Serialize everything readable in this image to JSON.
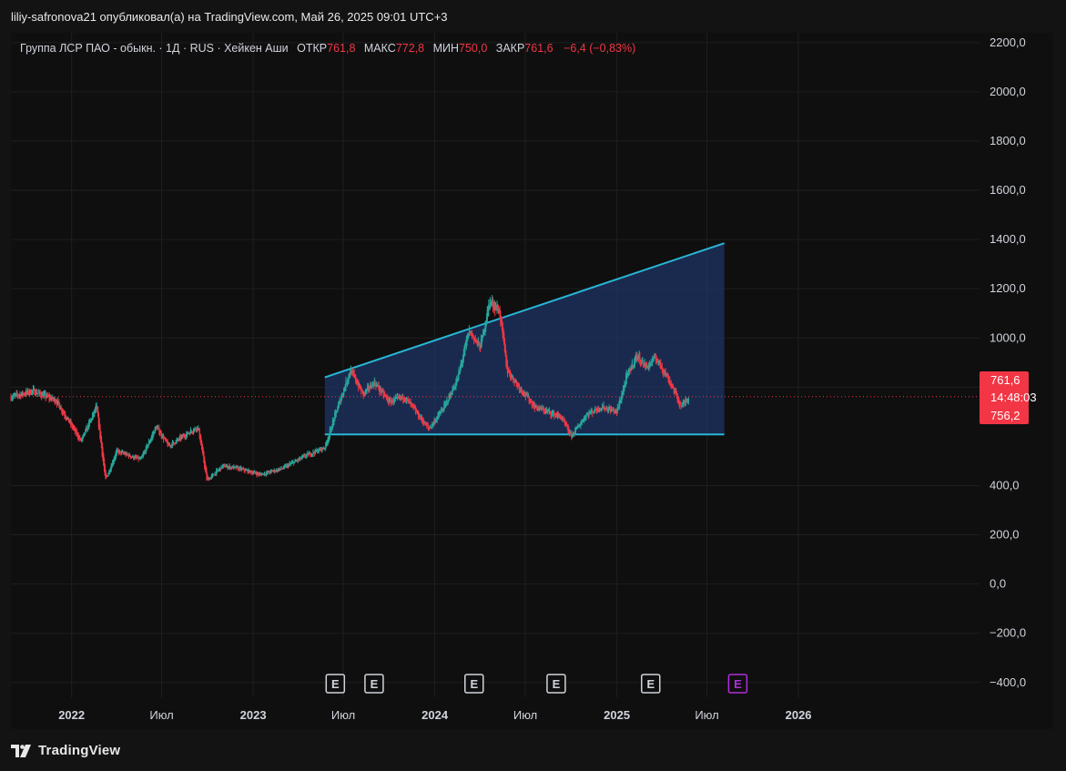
{
  "header": {
    "published_by": "liliy-safronova21 опубликовал(а) на TradingView.com, Май 26, 2025 09:01 UTC+3"
  },
  "legend": {
    "symbol": "Группа ЛСР ПАО - обыкн. · 1Д · RUS · Хейкен Аши",
    "open_label": "ОТКР",
    "open": "761,8",
    "high_label": "МАКС",
    "high": "772,8",
    "low_label": "МИН",
    "low": "750,0",
    "close_label": "ЗАКР",
    "close": "761,6",
    "change": "−6,4 (−0,83%)"
  },
  "price_tags": {
    "last": "761,6",
    "countdown": "14:48:03",
    "level": "756,2"
  },
  "footer": {
    "brand": "TradingView"
  },
  "colors": {
    "up": "#26a69a",
    "down": "#f23645",
    "trendline": "#29b6d6",
    "pattern_fill": "#1e3566",
    "earnings": "#d1d4dc",
    "earnings_upcoming": "#b02fd9"
  },
  "chart_data": {
    "type": "candlestick",
    "style": "Heikin Ashi",
    "y_axis": {
      "ticks": [
        -400,
        -200,
        0,
        200,
        400,
        800,
        1000,
        1200,
        1400,
        1600,
        1800,
        2000,
        2200
      ],
      "tick_labels": [
        "−400,0",
        "−200,0",
        "0,0",
        "200,0",
        "400,0",
        "800,0",
        "1000,0",
        "1200,0",
        "1400,0",
        "1600,0",
        "1800,0",
        "2000,0",
        "2200,0"
      ],
      "range": [
        -460,
        2240
      ]
    },
    "x_axis": {
      "range": [
        "2021-09-01",
        "2026-12-31"
      ],
      "ticks": [
        {
          "label": "2022",
          "date": "2022-01-01",
          "bold": true
        },
        {
          "label": "Июл",
          "date": "2022-07-01",
          "bold": false
        },
        {
          "label": "2023",
          "date": "2023-01-01",
          "bold": true
        },
        {
          "label": "Июл",
          "date": "2023-07-01",
          "bold": false
        },
        {
          "label": "2024",
          "date": "2024-01-01",
          "bold": true
        },
        {
          "label": "Июл",
          "date": "2024-07-01",
          "bold": false
        },
        {
          "label": "2025",
          "date": "2025-01-01",
          "bold": true
        },
        {
          "label": "Июл",
          "date": "2025-07-01",
          "bold": false
        },
        {
          "label": "2026",
          "date": "2026-01-01",
          "bold": true
        }
      ]
    },
    "last_price": 761.6,
    "price_path": [
      [
        "2021-09-01",
        760
      ],
      [
        "2021-10-15",
        785
      ],
      [
        "2021-12-01",
        745
      ],
      [
        "2022-01-20",
        580
      ],
      [
        "2022-02-20",
        720
      ],
      [
        "2022-03-10",
        420
      ],
      [
        "2022-04-01",
        540
      ],
      [
        "2022-05-20",
        505
      ],
      [
        "2022-06-20",
        640
      ],
      [
        "2022-07-15",
        560
      ],
      [
        "2022-08-20",
        610
      ],
      [
        "2022-09-12",
        640
      ],
      [
        "2022-09-30",
        420
      ],
      [
        "2022-11-01",
        480
      ],
      [
        "2022-12-01",
        470
      ],
      [
        "2023-01-15",
        445
      ],
      [
        "2023-03-01",
        470
      ],
      [
        "2023-04-15",
        520
      ],
      [
        "2023-05-25",
        555
      ],
      [
        "2023-06-15",
        690
      ],
      [
        "2023-07-15",
        870
      ],
      [
        "2023-08-10",
        770
      ],
      [
        "2023-09-01",
        820
      ],
      [
        "2023-10-01",
        740
      ],
      [
        "2023-11-01",
        760
      ],
      [
        "2023-12-20",
        630
      ],
      [
        "2024-01-20",
        720
      ],
      [
        "2024-02-15",
        830
      ],
      [
        "2024-03-10",
        1030
      ],
      [
        "2024-04-01",
        960
      ],
      [
        "2024-04-20",
        1150
      ],
      [
        "2024-05-10",
        1110
      ],
      [
        "2024-05-25",
        870
      ],
      [
        "2024-06-15",
        810
      ],
      [
        "2024-07-20",
        720
      ],
      [
        "2024-09-10",
        680
      ],
      [
        "2024-10-01",
        600
      ],
      [
        "2024-11-01",
        690
      ],
      [
        "2024-12-01",
        720
      ],
      [
        "2025-01-01",
        700
      ],
      [
        "2025-01-20",
        840
      ],
      [
        "2025-02-10",
        930
      ],
      [
        "2025-03-01",
        880
      ],
      [
        "2025-03-20",
        920
      ],
      [
        "2025-04-10",
        850
      ],
      [
        "2025-04-25",
        790
      ],
      [
        "2025-05-10",
        720
      ],
      [
        "2025-05-26",
        761.6
      ]
    ],
    "pattern": {
      "type": "ascending broadening wedge",
      "upper_line": [
        [
          "2023-05-25",
          840
        ],
        [
          "2025-08-05",
          1385
        ]
      ],
      "lower_line": [
        [
          "2023-05-25",
          608
        ],
        [
          "2025-08-05",
          608
        ]
      ]
    },
    "earnings_events": [
      {
        "date": "2023-06-15",
        "label": "E",
        "upcoming": false
      },
      {
        "date": "2023-09-01",
        "label": "E",
        "upcoming": false
      },
      {
        "date": "2024-03-20",
        "label": "E",
        "upcoming": false
      },
      {
        "date": "2024-09-01",
        "label": "E",
        "upcoming": false
      },
      {
        "date": "2025-03-10",
        "label": "E",
        "upcoming": false
      },
      {
        "date": "2025-09-01",
        "label": "E",
        "upcoming": true
      }
    ]
  }
}
